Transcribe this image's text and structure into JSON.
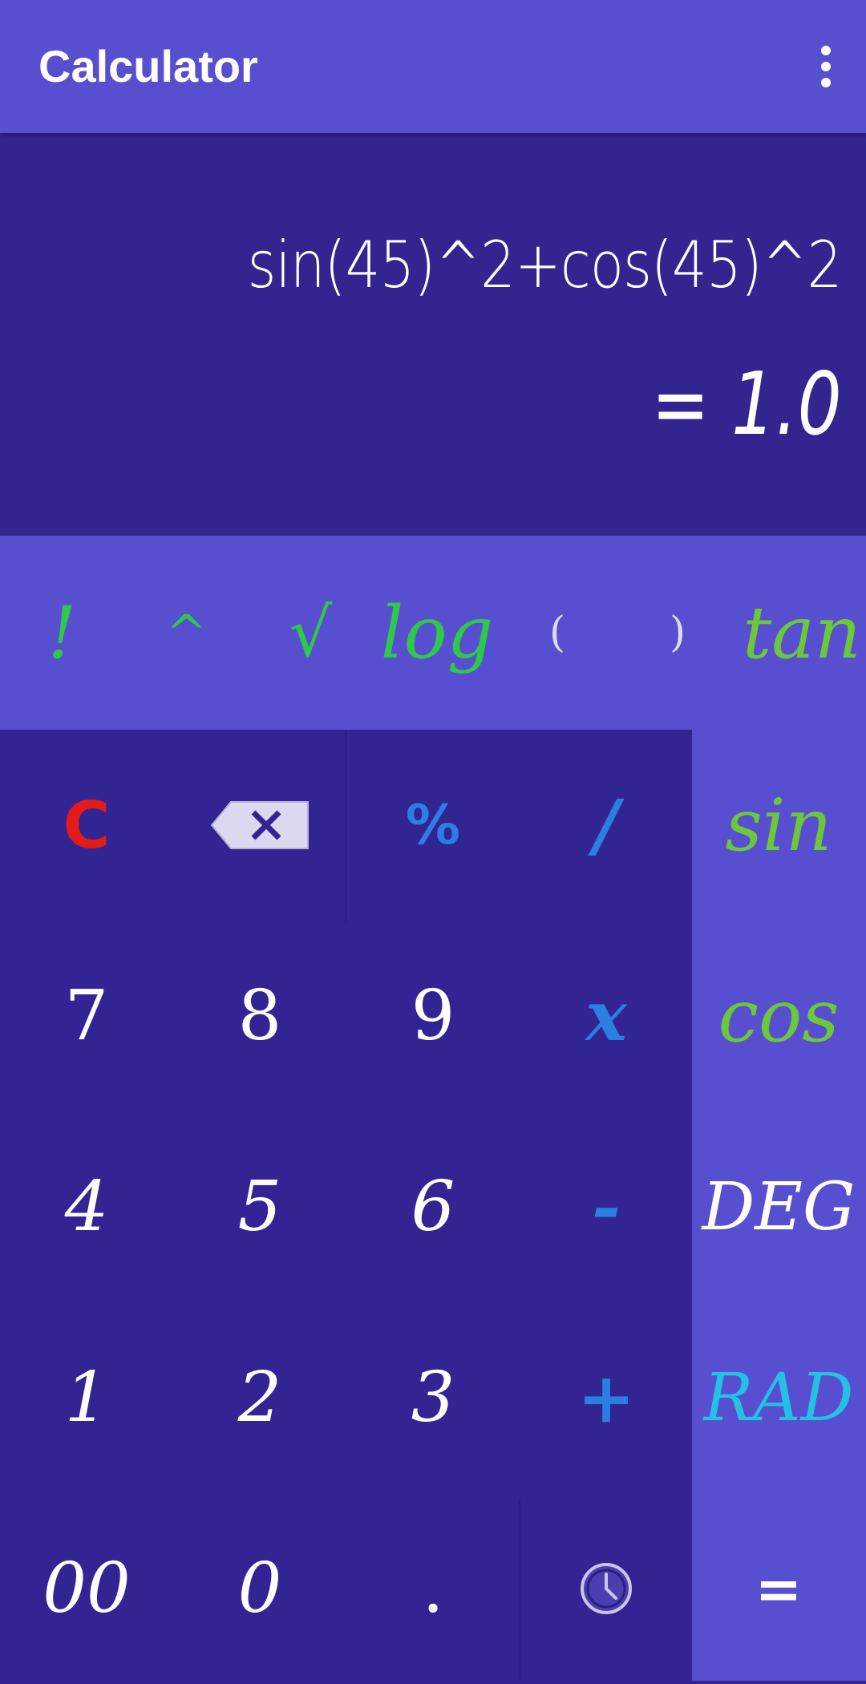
{
  "app": {
    "title": "Calculator"
  },
  "display": {
    "expression": "sin(45)^2+cos(45)^2",
    "result": "= 1.0"
  },
  "function_row": [
    {
      "label": "!"
    },
    {
      "label": "^"
    },
    {
      "label": "√"
    },
    {
      "label": "log"
    },
    {
      "label": "("
    },
    {
      "label": ")"
    },
    {
      "label": "tan"
    }
  ],
  "keypad": {
    "clear": "C",
    "percent": "%",
    "divide": "/",
    "multiply": "x",
    "minus": "-",
    "plus": "+",
    "decimal": ".",
    "double_zero": "00",
    "digits": [
      "0",
      "1",
      "2",
      "3",
      "4",
      "5",
      "6",
      "7",
      "8",
      "9"
    ]
  },
  "side": {
    "sin": "sin",
    "cos": "cos",
    "deg": "DEG",
    "rad": "RAD",
    "equals": "="
  },
  "icons": {
    "menu": "more-vert-icon",
    "backspace": "backspace-icon",
    "history": "clock-icon"
  },
  "colors": {
    "appbar": "#574fcf",
    "display": "#322590",
    "keypad": "#332493",
    "function_text": "#2ec84a",
    "operator_text": "#2b7fe0",
    "clear_text": "#e31b1b",
    "rad_text": "#26c0e6"
  }
}
